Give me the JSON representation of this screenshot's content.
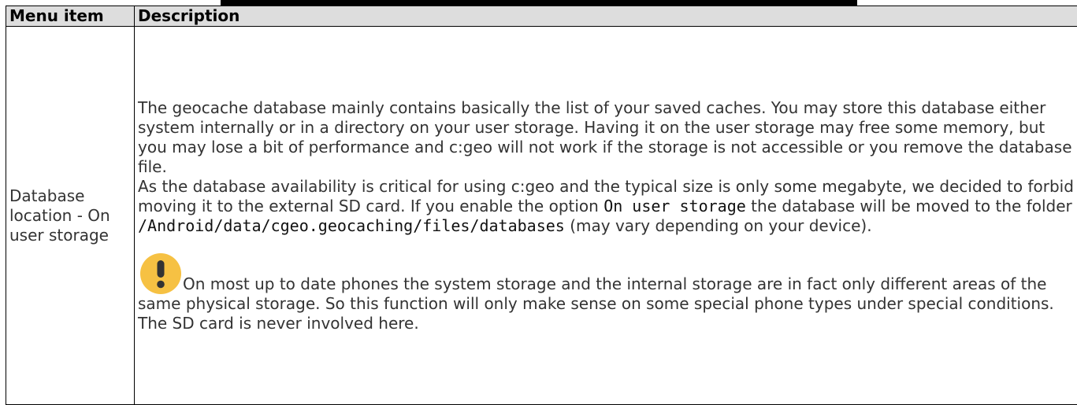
{
  "table": {
    "headers": {
      "menu_item": "Menu item",
      "description": "Description"
    },
    "row": {
      "menu_item": "Database location - On user storage",
      "paragraph1": "The geocache database mainly contains basically the list of your saved caches. You may store this database either system internally or in a directory on your user storage. Having it on the user storage may free some memory, but you may lose a bit of performance and c:geo will not work if the storage is not accessible or you remove the database file.",
      "paragraph2_part1": "As the database availability is critical for using c:geo and the typical size is only some megabyte, we decided to forbid moving it to the external SD card. If you enable the option ",
      "option_code": "On user storage",
      "paragraph2_part2": " the database will be moved to the folder ",
      "folder_code": "/Android/data/cgeo.geocaching/files/databases",
      "paragraph2_part3": " (may vary depending on your device).",
      "note_text": "On most up to date phones the system storage and the internal storage are in fact only different areas of the same physical storage. So this function will only make sense on some special phone types under special conditions. The SD card is never involved here."
    }
  },
  "icons": {
    "note": "exclamation-warning-icon"
  },
  "colors": {
    "header_bg": "#dddddd",
    "warning_icon": "#f6c143",
    "text": "#333333"
  }
}
